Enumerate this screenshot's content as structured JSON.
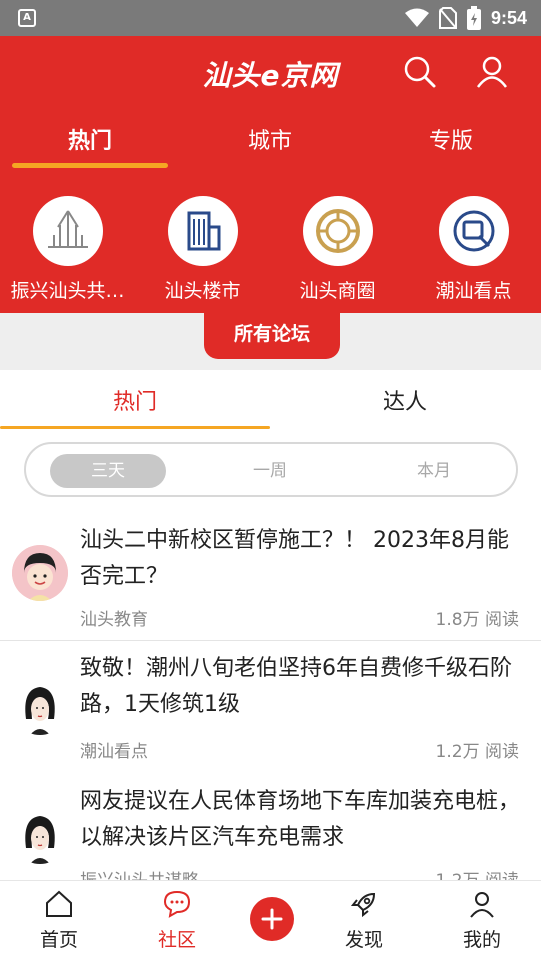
{
  "status_bar": {
    "notification_glyph": "A",
    "time": "9:54"
  },
  "header": {
    "logo_text": "汕头e京网",
    "search_icon": "search-icon",
    "profile_icon": "user-icon",
    "tabs": [
      {
        "label": "热门",
        "active": true
      },
      {
        "label": "城市",
        "active": false
      },
      {
        "label": "专版",
        "active": false
      }
    ],
    "forums": [
      {
        "label": "振兴汕头共…",
        "icon": "temple-icon"
      },
      {
        "label": "汕头楼市",
        "icon": "building-icon"
      },
      {
        "label": "汕头商圈",
        "icon": "mall-icon"
      },
      {
        "label": "潮汕看点",
        "icon": "tv-icon"
      }
    ],
    "all_forums_label": "所有论坛"
  },
  "sub_tabs": [
    {
      "label": "热门",
      "active": true
    },
    {
      "label": "达人",
      "active": false
    }
  ],
  "segments": [
    {
      "label": "三天",
      "active": true
    },
    {
      "label": "一周",
      "active": false
    },
    {
      "label": "本月",
      "active": false
    }
  ],
  "posts": [
    {
      "title": "汕头二中新校区暂停施工？！ 2023年8月能否完工？",
      "forum": "汕头教育",
      "reads": "1.8万 阅读"
    },
    {
      "title": "致敬！潮州八旬老伯坚持6年自费修千级石阶路，1天修筑1级",
      "forum": "潮汕看点",
      "reads": "1.2万 阅读"
    },
    {
      "title": "网友提议在人民体育场地下车库加装充电桩，以解决该片区汽车充电需求",
      "forum": "振兴汕头共谋略",
      "reads": "1.2万 阅读"
    }
  ],
  "bottom_nav": [
    {
      "label": "首页",
      "icon": "home-icon",
      "active": false
    },
    {
      "label": "社区",
      "icon": "chat-icon",
      "active": true
    },
    {
      "label": "",
      "icon": "add-icon",
      "active": false
    },
    {
      "label": "发现",
      "icon": "rocket-icon",
      "active": false
    },
    {
      "label": "我的",
      "icon": "user-icon",
      "active": false
    }
  ],
  "colors": {
    "brand_red": "#e02b27",
    "accent_orange": "#f5a623"
  }
}
